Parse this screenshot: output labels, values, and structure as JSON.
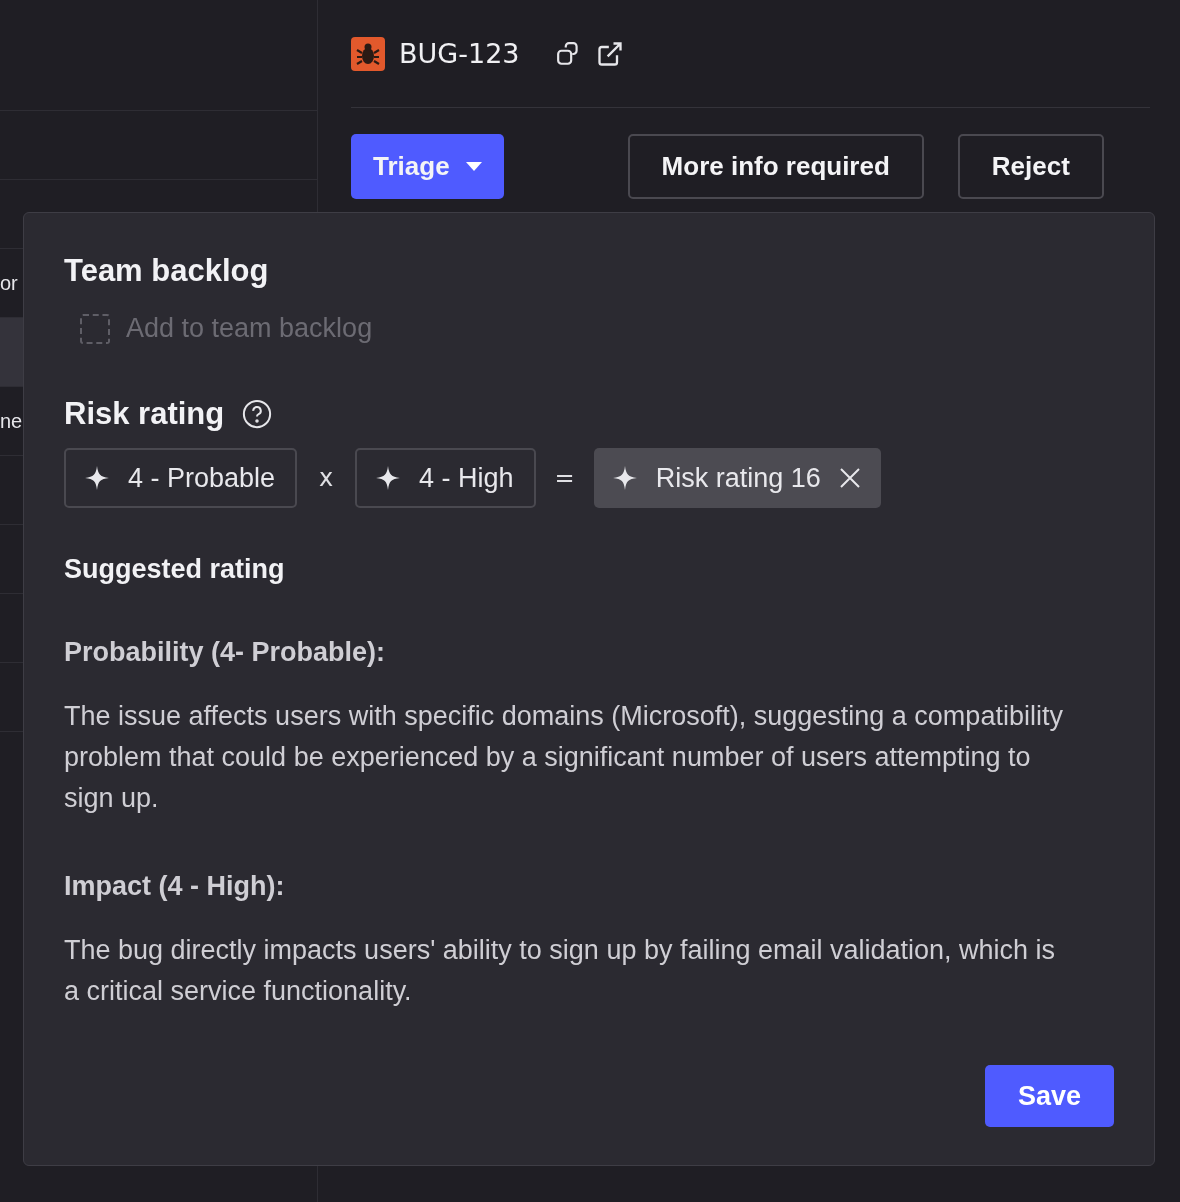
{
  "list": {
    "rows": [
      {
        "selected": false
      },
      {
        "selected": false
      },
      {
        "text": "or",
        "selected": false
      },
      {
        "selected": true
      },
      {
        "text": "ne",
        "selected": false
      },
      {
        "selected": false
      },
      {
        "selected": false
      },
      {
        "selected": false
      },
      {
        "selected": false
      },
      {
        "selected": false
      }
    ]
  },
  "issue": {
    "key": "BUG-123"
  },
  "actions": [
    {
      "label": "Triage",
      "kind": "primary"
    },
    {
      "label": "More info required",
      "kind": "outline"
    },
    {
      "label": "Reject",
      "kind": "outline"
    }
  ],
  "popover": {
    "team_backlog": {
      "title": "Team backlog",
      "option": {
        "label": "Add to team backlog",
        "checked": false,
        "disabled": true
      }
    },
    "risk_rating": {
      "title": "Risk rating",
      "factors": [
        {
          "kind": "select",
          "label": "4 - Probable"
        },
        {
          "kind": "operator",
          "label": "x"
        },
        {
          "kind": "select",
          "label": "4 - High"
        },
        {
          "kind": "operator",
          "label": "="
        },
        {
          "kind": "result",
          "label": "Risk rating 16"
        }
      ]
    },
    "suggestion": {
      "title": "Suggested rating",
      "sections": [
        {
          "heading": "Probability (4- Probable):",
          "body": "The issue affects users with specific domains (Microsoft), suggesting a compatibility problem that could be experienced by a significant number of users attempting to sign up."
        },
        {
          "heading": "Impact (4 - High):",
          "body": "The bug directly impacts users' ability to sign up by failing email validation, which is a critical service functionality."
        }
      ]
    },
    "save": "Save"
  }
}
